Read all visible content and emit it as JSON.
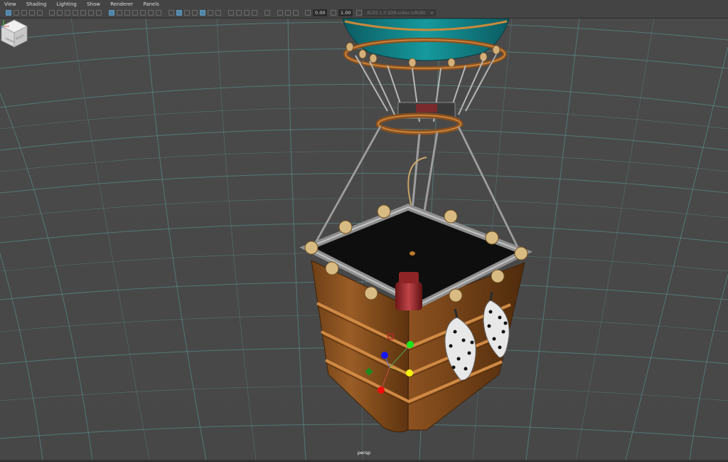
{
  "menu": [
    "View",
    "Shading",
    "Lighting",
    "Show",
    "Renderer",
    "Panels"
  ],
  "toolbar": {
    "field_a": "0.00",
    "field_b": "1.00",
    "colorspace": "ACES 1.0 SDR-video (sRGB)"
  },
  "viewport": {
    "camera_label": "persp",
    "viewcube_left": "FRONT",
    "viewcube_right": "RIGHT"
  },
  "colors": {
    "background": "#494949",
    "grid": "#6fbab5",
    "selection": "#5285a6",
    "basket": "#8a5524",
    "balloon": "#0d7e83"
  },
  "icons": [
    "select-icon",
    "camera-icon",
    "grid-icon",
    "wireframe-icon",
    "shaded-icon",
    "light-icon",
    "isolate-icon",
    "xray-icon",
    "colorspace-icon"
  ]
}
